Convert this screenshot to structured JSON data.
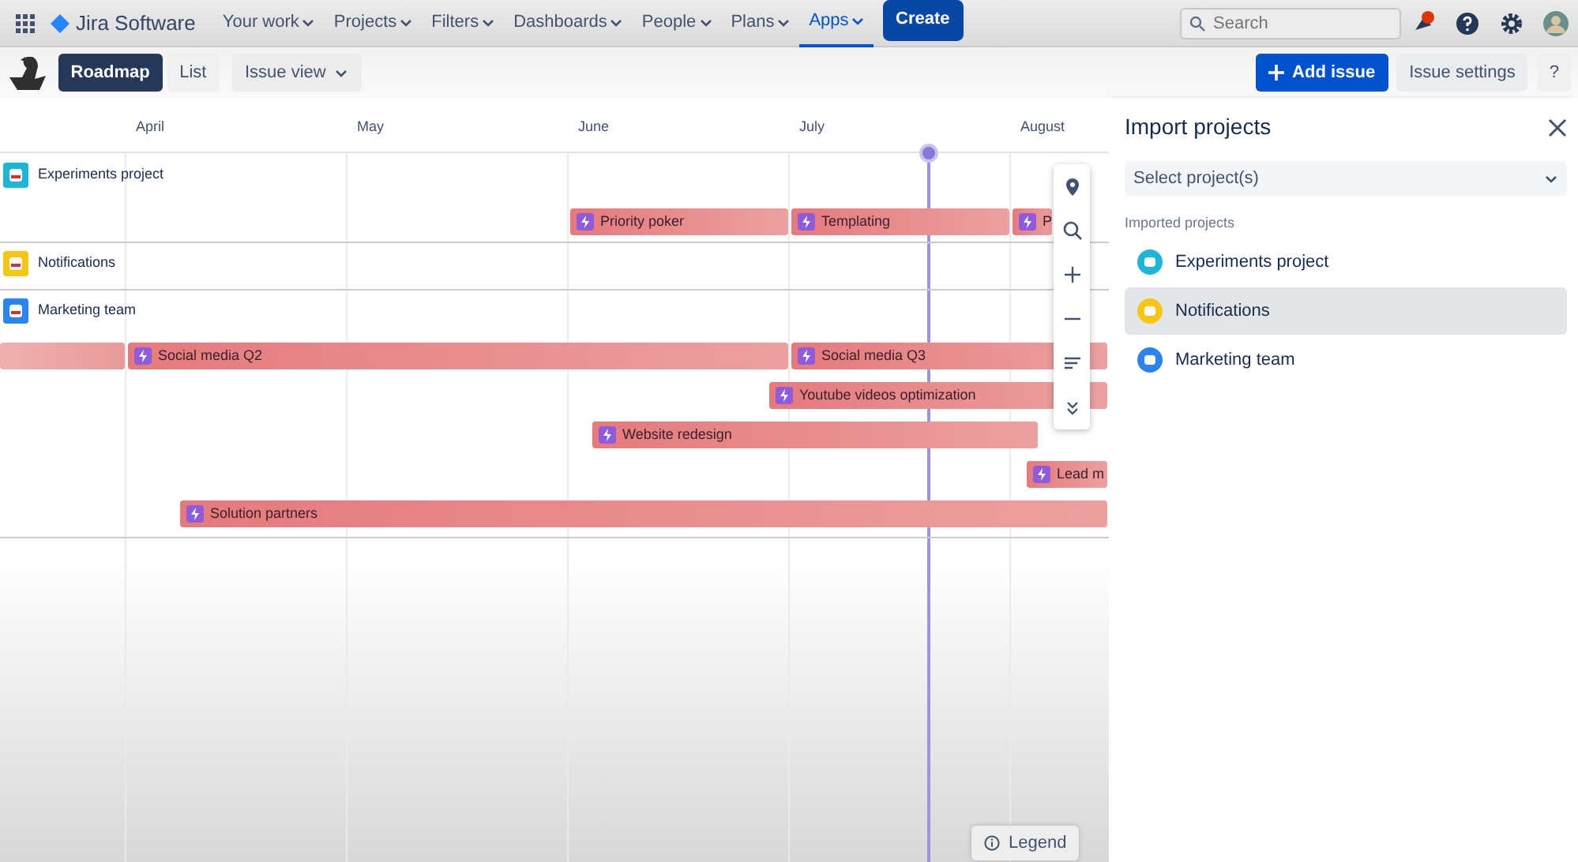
{
  "topbar": {
    "product": "Jira Software",
    "nav": [
      {
        "label": "Your work",
        "selected": false
      },
      {
        "label": "Projects",
        "selected": false
      },
      {
        "label": "Filters",
        "selected": false
      },
      {
        "label": "Dashboards",
        "selected": false
      },
      {
        "label": "People",
        "selected": false
      },
      {
        "label": "Plans",
        "selected": false
      },
      {
        "label": "Apps",
        "selected": true
      }
    ],
    "create": "Create",
    "search": {
      "placeholder": "Search"
    }
  },
  "toolbar": {
    "views": [
      {
        "label": "Roadmap",
        "selected": true
      },
      {
        "label": "List",
        "selected": false
      }
    ],
    "issue_view": "Issue view",
    "add_issue": "Add issue",
    "issue_settings": "Issue settings",
    "help": "?"
  },
  "timeline": {
    "months": [
      "April",
      "May",
      "June",
      "July",
      "August"
    ],
    "projects": [
      {
        "name": "Experiments project",
        "color": "#1fb5d6",
        "bars": [
          {
            "label": "Priority poker"
          },
          {
            "label": "Templating"
          },
          {
            "label": "P"
          }
        ]
      },
      {
        "name": "Notifications",
        "color": "#f5c518"
      },
      {
        "name": "Marketing team",
        "color": "#2d84f0",
        "bars": [
          {
            "kind": "continuation"
          },
          {
            "label": "Social media Q2"
          },
          {
            "label": "Social media Q3"
          },
          {
            "label": "Youtube videos optimization"
          },
          {
            "label": "Website redesign"
          },
          {
            "label": "Lead m"
          },
          {
            "label": "Solution partners"
          }
        ]
      }
    ],
    "legend": "Legend"
  },
  "panel": {
    "title": "Import projects",
    "select_placeholder": "Select project(s)",
    "section": "Imported projects",
    "items": [
      {
        "name": "Experiments project",
        "color": "#1fb5d6",
        "selected": false
      },
      {
        "name": "Notifications",
        "color": "#f5c518",
        "selected": true
      },
      {
        "name": "Marketing team",
        "color": "#2d84f0",
        "selected": false
      }
    ]
  }
}
